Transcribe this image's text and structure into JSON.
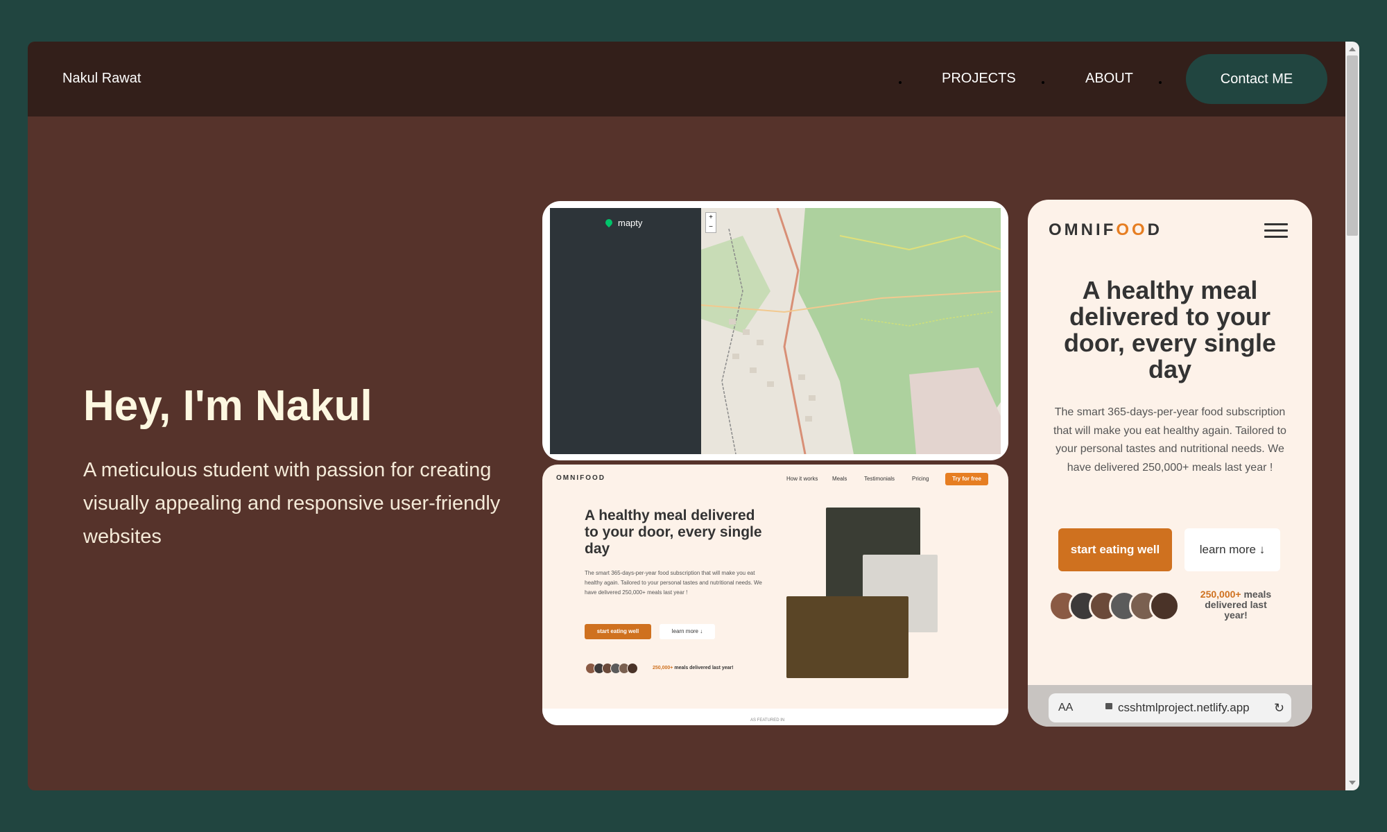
{
  "nav": {
    "brand": "Nakul Rawat",
    "links": [
      "PROJECTS",
      "ABOUT"
    ],
    "contact_label": "Contact ME"
  },
  "hero": {
    "title": "Hey, I'm Nakul",
    "subtitle": "A meticulous student with passion for creating visually appealing and responsive user-friendly websites"
  },
  "projects": {
    "mapty": {
      "logo": "mapty",
      "zoom_in": "+",
      "zoom_out": "−"
    },
    "omnifood_desktop": {
      "logo": "OMNIFOOD",
      "nav_links": [
        "How it works",
        "Meals",
        "Testimonials",
        "Pricing"
      ],
      "cta": "Try for free",
      "heading": "A healthy meal delivered to your door, every single day",
      "text": "The smart 365-days-per-year food subscription that will make you eat healthy again. Tailored to your personal tastes and nutritional needs. We have delivered 250,000+ meals last year !",
      "btn_primary": "start eating well",
      "btn_secondary": "learn more ↓",
      "meals_count": "250,000+",
      "meals_text": "meals delivered last year!",
      "footer_text": "AS FEATURED IN"
    },
    "omnifood_mobile": {
      "logo_left": "OMNIF",
      "logo_oo": "OO",
      "logo_right": "D",
      "heading": "A healthy meal delivered to your door, every single day",
      "text": "The smart 365-days-per-year food subscription that will make you eat healthy again. Tailored to your personal tastes and nutritional needs. We have delivered 250,000+ meals last year !",
      "btn_primary": "start eating well",
      "btn_secondary": "learn more ↓",
      "meals_count": "250,000+",
      "meals_text": "meals delivered last year!",
      "browser": {
        "text_size": "AA",
        "url": "csshtmlproject.netlify.app",
        "reload_icon": "reload-icon"
      }
    }
  },
  "colors": {
    "page_bg": "#214540",
    "nav_bg": "#331f1a",
    "hero_bg": "#56332b",
    "accent": "#cf711f",
    "cream": "#fdf2e9"
  }
}
